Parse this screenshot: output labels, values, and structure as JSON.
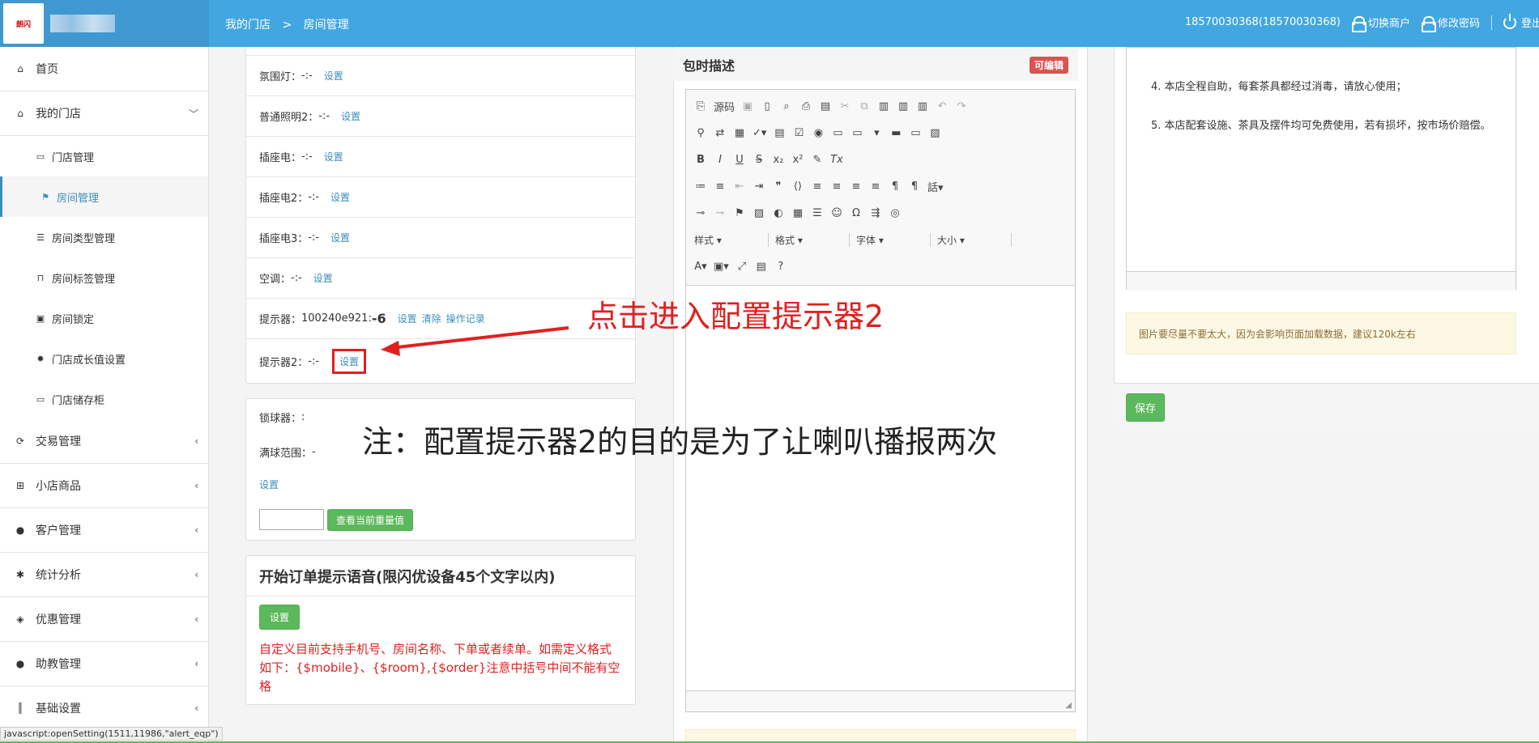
{
  "header": {
    "logo_text": "朗闪",
    "breadcrumb": [
      "我的门店",
      ">",
      "房间管理"
    ],
    "account": "18570030368(18570030368)",
    "switch_merchant": "切换商户",
    "change_password": "修改密码",
    "logout": "登出"
  },
  "sidebar": {
    "items": [
      {
        "label": "首页",
        "icon": "home-icon"
      },
      {
        "label": "我的门店",
        "icon": "home-icon"
      },
      {
        "label": "交易管理",
        "icon": "refresh-icon"
      },
      {
        "label": "小店商品",
        "icon": "gift-icon"
      },
      {
        "label": "客户管理",
        "icon": "user-icon"
      },
      {
        "label": "统计分析",
        "icon": "gear-icon"
      },
      {
        "label": "优惠管理",
        "icon": "tags-icon"
      },
      {
        "label": "助教管理",
        "icon": "user-icon"
      },
      {
        "label": "基础设置",
        "icon": "barcode-icon"
      }
    ],
    "sub_items": [
      {
        "label": "门店管理"
      },
      {
        "label": "房间管理"
      },
      {
        "label": "房间类型管理"
      },
      {
        "label": "房间标签管理"
      },
      {
        "label": "房间锁定"
      },
      {
        "label": "门店成长值设置"
      },
      {
        "label": "门店储存柜"
      }
    ]
  },
  "devices": {
    "rows": [
      {
        "label": "氛围灯：",
        "value": "-:-",
        "action": "设置"
      },
      {
        "label": "普通照明2：",
        "value": "-:-",
        "action": "设置"
      },
      {
        "label": "插座电：",
        "value": "-:-",
        "action": "设置"
      },
      {
        "label": "插座电2：",
        "value": "-:-",
        "action": "设置"
      },
      {
        "label": "插座电3：",
        "value": "-:-",
        "action": "设置"
      },
      {
        "label": "空调：",
        "value": "-:-",
        "action": "设置"
      }
    ],
    "prompter": {
      "label": "提示器：",
      "id": "100240e921:",
      "value": "-6",
      "actions": [
        "设置",
        "清除",
        "操作记录"
      ]
    },
    "prompter2": {
      "label": "提示器2：",
      "value": "-:-",
      "action": "设置"
    }
  },
  "ball": {
    "lock_label": "锁球器：",
    "lock_value": ":",
    "range_label": "满球范围：",
    "range_value": "-",
    "set_link": "设置",
    "weight_button": "查看当前重量值"
  },
  "order_voice": {
    "title": "开始订单提示语音(限闪优设备45个文字以内)",
    "button": "设置",
    "note": "自定义目前支持手机号、房间名称、下单或者续单。如需定义格式如下：{$mobile}、{$room},{$order}注意中括号中间不能有空格"
  },
  "package": {
    "title": "包时描述",
    "badge": "可编辑",
    "toolbar_source": "源码",
    "styles": [
      "样式",
      "格式",
      "字体",
      "大小"
    ]
  },
  "preview": {
    "line4": "4. 本店全程自助，每套茶具都经过消毒，请放心使用；",
    "line5": "5. 本店配套设施、茶具及摆件均可免费使用，若有损坏，按市场价赔偿。"
  },
  "notice": "图片要尽量不要太大，因为会影响页面加载数据，建议120k左右",
  "save_button": "保存",
  "status_url": "javascript:openSetting(1511,11986,\"alert_eqp\")",
  "annotations": {
    "arrow_text": "点击进入配置提示器2",
    "note_text": "注：配置提示器2的目的是为了让喇叭播报两次"
  },
  "colors": {
    "topbar": "#42a7e0",
    "accent": "#3c8dbc",
    "annotation": "#e02020",
    "green": "#5cb85c"
  }
}
